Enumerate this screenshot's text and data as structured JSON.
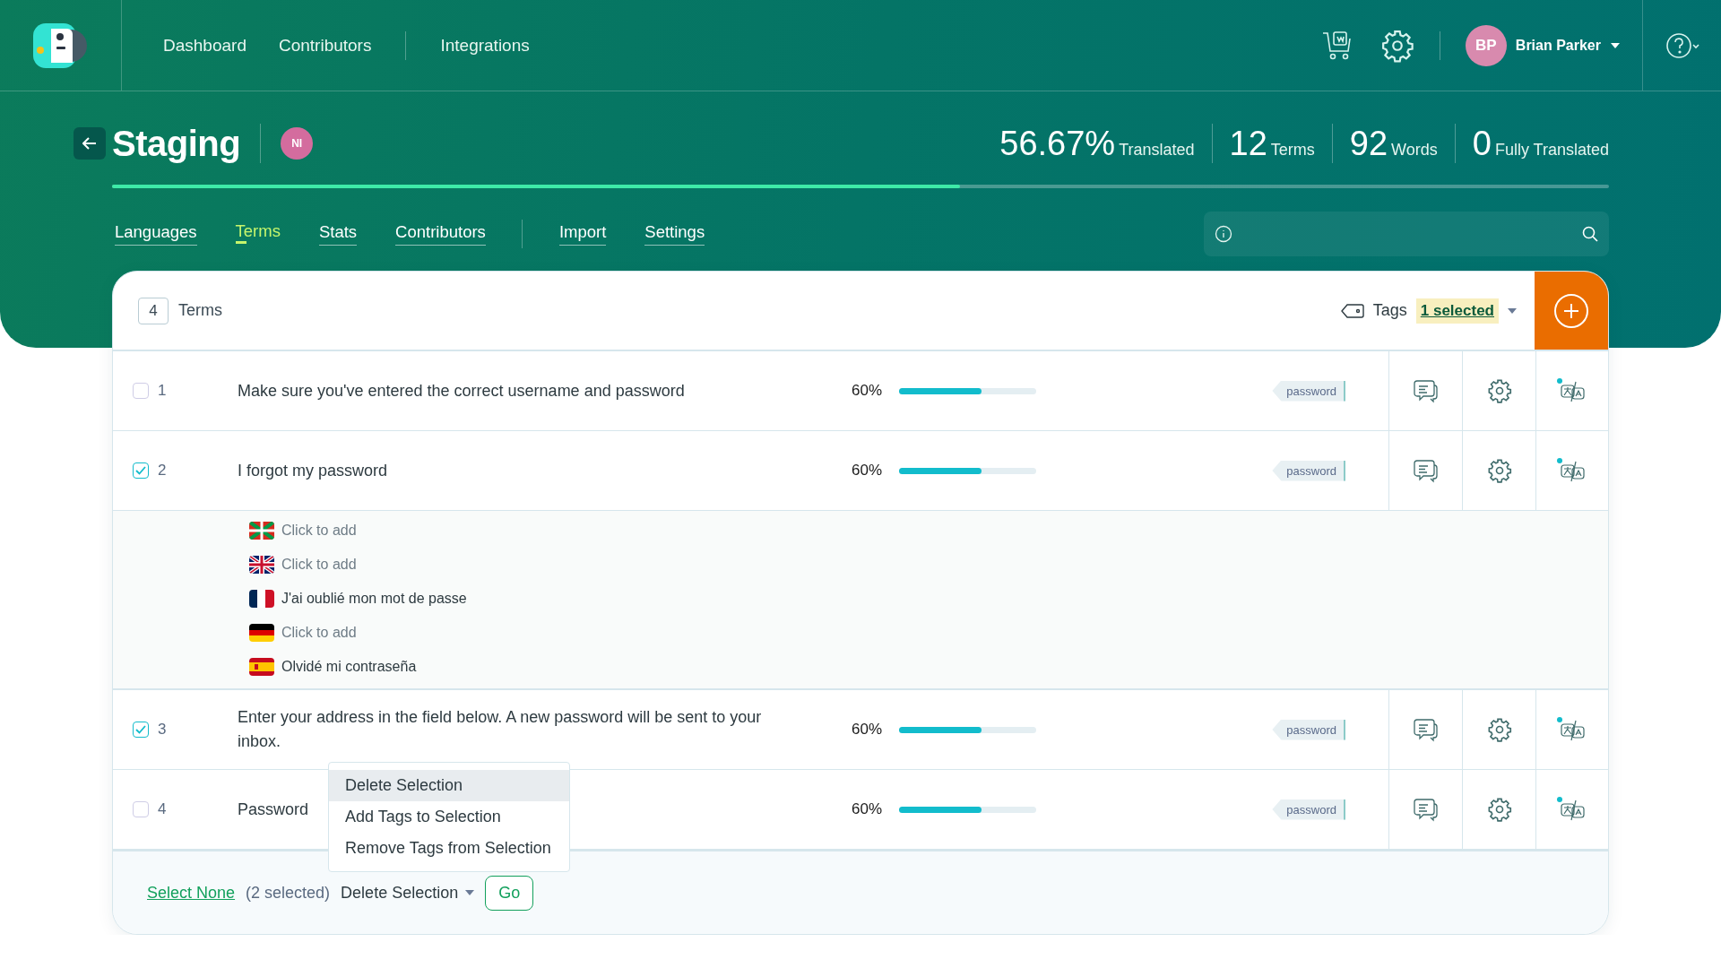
{
  "header": {
    "nav_groups": [
      {
        "items": [
          {
            "label": "Dashboard"
          },
          {
            "label": "Contributors"
          }
        ]
      },
      {
        "items": [
          {
            "label": "Integrations"
          }
        ]
      }
    ],
    "user": {
      "initials": "BP",
      "name": "Brian Parker"
    }
  },
  "project": {
    "title": "Staging",
    "badge": "NI",
    "stats": [
      {
        "value": "56.67%",
        "label": "Translated"
      },
      {
        "value": "12",
        "label": "Terms"
      },
      {
        "value": "92",
        "label": "Words"
      },
      {
        "value": "0",
        "label": "Fully Translated"
      }
    ],
    "progress": {
      "level": 0.5667
    }
  },
  "tab_groups": [
    {
      "tabs": [
        {
          "label": "Languages",
          "selected": false
        },
        {
          "label": "Terms",
          "selected": true
        },
        {
          "label": "Stats",
          "selected": false
        },
        {
          "label": "Contributors",
          "selected": false
        }
      ]
    },
    {
      "tabs": [
        {
          "label": "Import",
          "selected": false
        },
        {
          "label": "Settings",
          "selected": false
        }
      ]
    }
  ],
  "terms_panel": {
    "count": "4",
    "title": "Terms",
    "tags_label": "Tags",
    "tags_filter": "1 selected"
  },
  "rows": [
    {
      "number": "1",
      "text": "Make sure you've entered the correct username and password",
      "checked": false,
      "percent": "60%",
      "level": 0.6,
      "tag": "password",
      "expanded": false
    },
    {
      "number": "2",
      "text": "I forgot my password",
      "checked": true,
      "percent": "60%",
      "level": 0.6,
      "tag": "password",
      "expanded": true,
      "translations": [
        {
          "kind": "basque",
          "text": "Click to add",
          "missing": true
        },
        {
          "kind": "uk",
          "text": "Click to add",
          "missing": true
        },
        {
          "kind": "france",
          "text": "J'ai oublié mon mot de passe",
          "missing": false
        },
        {
          "kind": "germany",
          "text": "Click to add",
          "missing": true
        },
        {
          "kind": "spain",
          "text": "Olvidé mi contraseña",
          "missing": false
        }
      ]
    },
    {
      "number": "3",
      "text": "Enter your address in the field below. A new password will be sent to your inbox.",
      "checked": true,
      "percent": "60%",
      "level": 0.6,
      "tag": "password",
      "expanded": false
    },
    {
      "number": "4",
      "text": "Password",
      "checked": false,
      "percent": "60%",
      "level": 0.6,
      "tag": "password",
      "expanded": false
    }
  ],
  "bulk_menu": {
    "items": [
      {
        "label": "Delete Selection",
        "selected": true
      },
      {
        "label": "Add Tags to Selection",
        "selected": false
      },
      {
        "label": "Remove Tags from Selection",
        "selected": false
      }
    ]
  },
  "footer": {
    "select_none": "Select None",
    "selected_count": "(2 selected)",
    "action": "Delete Selection",
    "go": "Go"
  }
}
